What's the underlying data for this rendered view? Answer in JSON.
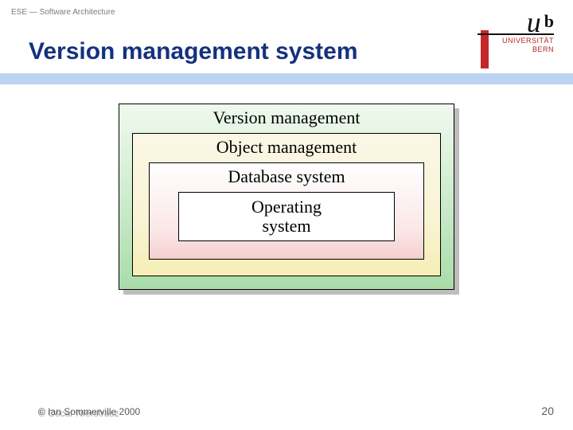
{
  "header": {
    "breadcrumb": "ESE — Software Architecture",
    "title": "Version management system",
    "logo": {
      "u": "u",
      "b": "b",
      "sub1": "UNIVERSITÄT",
      "sub2": "BERN"
    }
  },
  "diagram": {
    "layers": [
      "Version management",
      "Object management",
      "Database system",
      "Operating system"
    ]
  },
  "footer": {
    "copyright1": "© Ian Sommerville 2000",
    "copyright2": "© Oscar Nierstrasz",
    "page": "20"
  }
}
